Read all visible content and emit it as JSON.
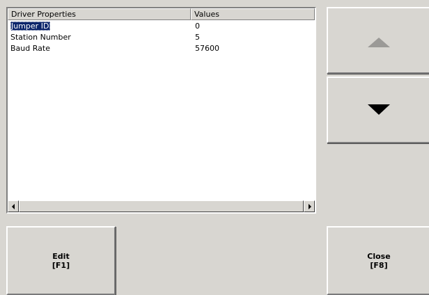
{
  "list": {
    "columns": [
      "Driver Properties",
      "Values"
    ],
    "rows": [
      {
        "property": "Jumper ID",
        "value": "0",
        "selected": true
      },
      {
        "property": "Station Number",
        "value": "5",
        "selected": false
      },
      {
        "property": "Baud Rate",
        "value": "57600",
        "selected": false
      }
    ]
  },
  "buttons": {
    "scroll_up_icon": "triangle-up",
    "scroll_down_icon": "triangle-down",
    "edit_label": "Edit",
    "edit_key": "[F1]",
    "close_label": "Close",
    "close_key": "[F8]"
  },
  "colors": {
    "background": "#d8d6d1",
    "selection": "#0a246a",
    "disabled_arrow": "#9b9a97"
  }
}
